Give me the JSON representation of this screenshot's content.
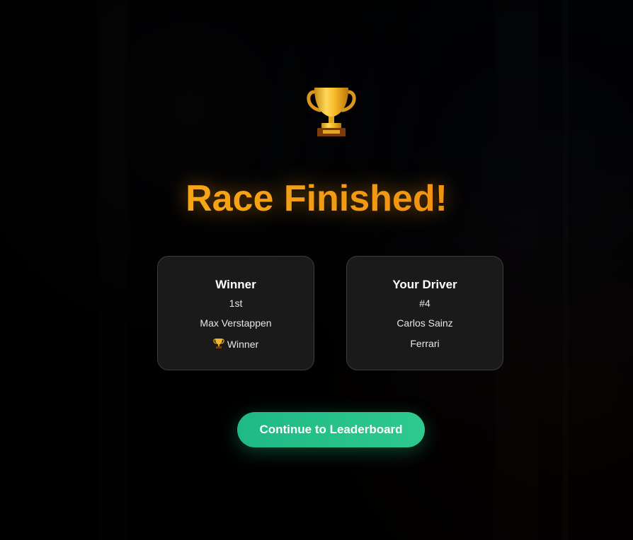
{
  "screen": {
    "title": "Race Finished!",
    "icon": "trophy-icon"
  },
  "winner_card": {
    "heading": "Winner",
    "position": "1st",
    "driver_name": "Max Verstappen",
    "badge_label": "Winner",
    "badge_icon": "trophy-icon"
  },
  "driver_card": {
    "heading": "Your Driver",
    "number": "#4",
    "driver_name": "Carlos Sainz",
    "team": "Ferrari"
  },
  "actions": {
    "continue_label": "Continue to Leaderboard"
  },
  "colors": {
    "title_gradient_start": "#fbb516",
    "title_gradient_end": "#e9860f",
    "button_start": "#1fb985",
    "button_end": "#2ec98f",
    "card_background": "#1a1a1a",
    "card_border": "#3c3c3c"
  }
}
